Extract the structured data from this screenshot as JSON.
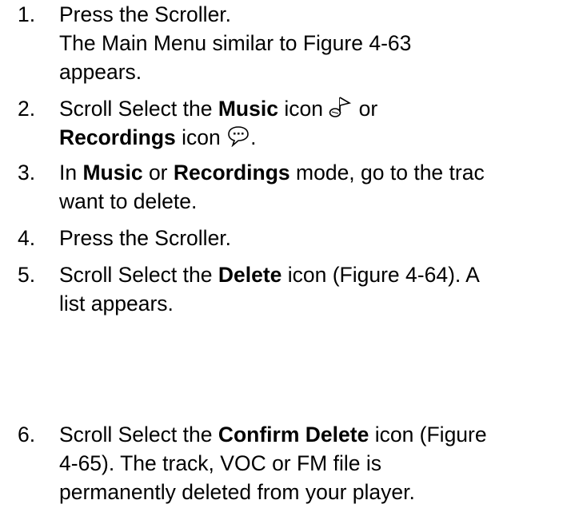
{
  "steps": [
    {
      "number": "1.",
      "lines": [
        "Press the Scroller.",
        "The Main Menu similar to Figure 4-63",
        "appears."
      ]
    },
    {
      "number": "2.",
      "line1": {
        "pre": "Scroll Select the ",
        "bold": "Music",
        "post": " icon ",
        "icon": "music-note-icon",
        "tail": " or"
      },
      "line2": {
        "bold": "Recordings",
        "post": " icon ",
        "icon": "speech-bubble-icon",
        "tail": "."
      }
    },
    {
      "number": "3.",
      "line1": {
        "pre": "In ",
        "bold1": "Music",
        "mid": " or ",
        "bold2": "Recordings",
        "post": " mode, go to the trac"
      },
      "line2": "want to delete."
    },
    {
      "number": "4.",
      "lines": [
        "Press the Scroller."
      ]
    },
    {
      "number": "5.",
      "line1": {
        "pre": "Scroll Select the ",
        "bold": "Delete",
        "post": " icon (Figure 4-64). A"
      },
      "line2": "list appears."
    },
    {
      "number": "6.",
      "line1": {
        "pre": "Scroll Select the ",
        "bold": "Confirm Delete",
        "post": " icon (Figure"
      },
      "line2": "4-65). The track, VOC or FM file is",
      "line3": "permanently deleted from your player."
    }
  ]
}
